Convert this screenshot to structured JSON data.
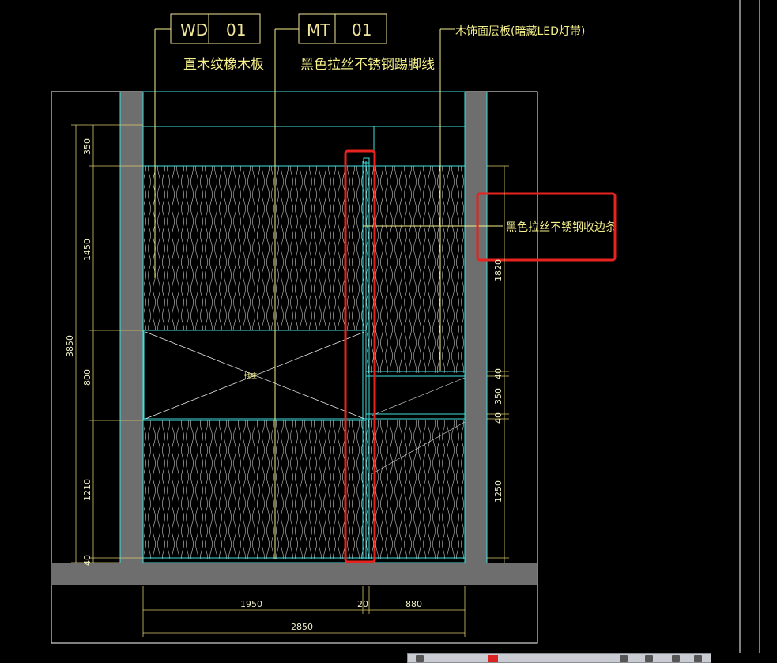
{
  "tags": [
    {
      "code": "WD",
      "num": "01",
      "name": "直木纹橡木板"
    },
    {
      "code": "MT",
      "num": "01",
      "name": "黑色拉丝不锈钢踢脚线"
    }
  ],
  "top_label": "木饰面层板(暗藏LED灯带)",
  "callout_label": "黑色拉丝不锈钢收边条",
  "center_mark": "插座",
  "dims_left": [
    "3850",
    "350",
    "1450",
    "800",
    "1210",
    "40"
  ],
  "dims_right": [
    "1820",
    "40",
    "350",
    "40",
    "1250"
  ],
  "dims_bottom": [
    "1950",
    "20",
    "880",
    "2850"
  ],
  "colors": {
    "background": "#000000",
    "cyan": "#3fe0e0",
    "yellow": "#f5f08a",
    "gray_wall": "#6e6e6e",
    "white": "#ffffff",
    "highlight_red": "#e8231f"
  }
}
